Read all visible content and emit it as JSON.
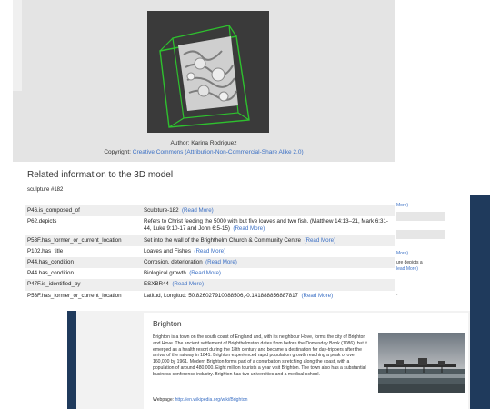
{
  "model": {
    "author_text": "Author: Karina Rodriguez",
    "copyright_label": "Copyright:",
    "copyright_link": "Creative Commons (Attribution-Non-Commercial-Share Alike 2.0)"
  },
  "related": {
    "heading": "Related information to the 3D model",
    "subtitle": "sculpture #182",
    "rows": [
      {
        "key": "P46.is_composed_of",
        "value": "Sculpture-182",
        "link": "(Read More)"
      },
      {
        "key": "P62.depicts",
        "value": "Refers to Christ feeding the 5000 with but five loaves and two fish. (Matthew 14:13–21, Mark 6:31-44, Luke 9:10-17 and John 6:5-15)",
        "link": "(Read More)"
      },
      {
        "key": "P53F.has_former_or_current_location",
        "value": "Set into the wall of the Brighthelm Church & Community Centre",
        "link": "(Read More)"
      },
      {
        "key": "P102.has_title",
        "value": "Loaves and Fishes",
        "link": "(Read More)"
      },
      {
        "key": "P44.has_condition",
        "value": "Corrosion, deterioration",
        "link": "(Read More)"
      },
      {
        "key": "P44.has_condition",
        "value": "Biological growth",
        "link": "(Read More)"
      },
      {
        "key": "P47F.is_identified_by",
        "value": "ESXBR44",
        "link": "(Read More)"
      },
      {
        "key": "P53F.has_former_or_current_location",
        "value": "Latitud, Longitud: 50.826027910088506,-0.141888856887817",
        "link": "(Read More)"
      }
    ]
  },
  "background_panel": {
    "snippets": [
      "More)",
      "More)",
      "ure depicts a",
      "lead More)",
      "·"
    ]
  },
  "brighton": {
    "title": "Brighton",
    "text": "Brighton is a town on the south coast of England and, with its neighbour Hove, forms the city of Brighton and Hove. The ancient settlement of Brighthelmston dates from before the Domesday Book (1086), but it emerged as a health resort during the 18th century and became a destination for day-trippers after the arrival of the railway in 1841. Brighton experienced rapid population growth reaching a peak of over 160,000 by 1961. Modern Brighton forms part of a conurbation stretching along the coast, with a population of around 480,000. Eight million tourists a year visit Brighton. The town also has a substantial business conference industry. Brighton has two universities and a medical school.",
    "webpage_label": "Webpage:",
    "webpage_url": "http://en.wikipedia.org/wiki/Brighton"
  }
}
